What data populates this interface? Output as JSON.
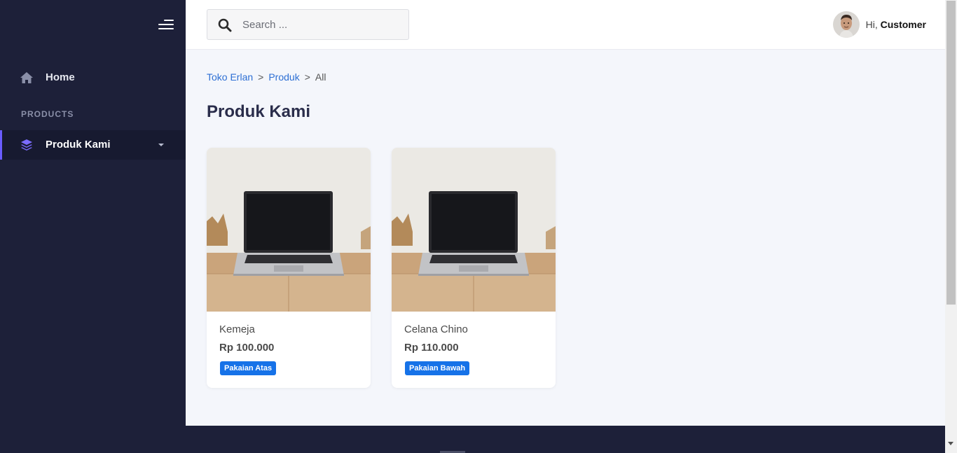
{
  "sidebar": {
    "home_label": "Home",
    "section_title": "PRODUCTS",
    "active_item_label": "Produk Kami"
  },
  "topbar": {
    "search_placeholder": "Search ...",
    "greeting": "Hi,",
    "user_name": "Customer"
  },
  "breadcrumb": {
    "items": [
      "Toko Erlan",
      "Produk",
      "All"
    ],
    "separator": ">"
  },
  "page": {
    "title": "Produk Kami"
  },
  "products": [
    {
      "name": "Kemeja",
      "price": "Rp 100.000",
      "category": "Pakaian Atas"
    },
    {
      "name": "Celana Chino",
      "price": "Rp 110.000",
      "category": "Pakaian Bawah"
    }
  ],
  "colors": {
    "sidebar_bg": "#1d2039",
    "accent": "#6a5cff",
    "link": "#2d6fd4",
    "badge": "#1672e8"
  }
}
